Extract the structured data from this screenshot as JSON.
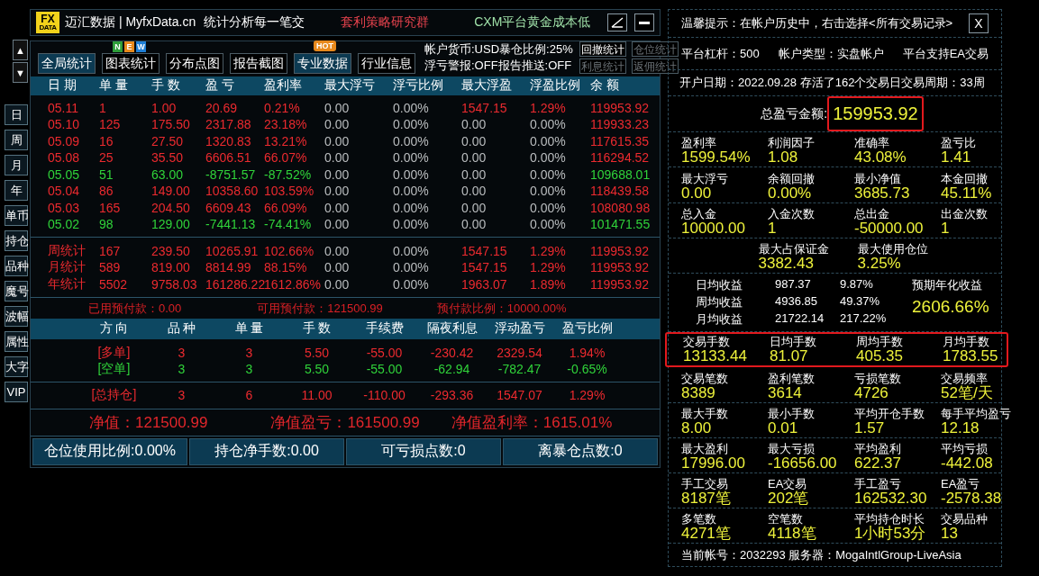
{
  "title_bar": {
    "logo": {
      "top": "FX",
      "bottom": "DATA"
    },
    "title": "迈汇数据 | MyfxData.cn",
    "slogan": "统计分析每一笔交",
    "promo": "套利策略研究群",
    "notice": "CXM平台黄金成本低"
  },
  "arrows": [
    "▲",
    "▼"
  ],
  "side_tabs": [
    "日",
    "周",
    "月",
    "年",
    "单币",
    "持仓",
    "品种",
    "魔号",
    "波幅",
    "属性",
    "大字",
    "VIP"
  ],
  "toolbar": [
    {
      "label": "全局统计",
      "selected": true
    },
    {
      "label": "图表统计",
      "selected": false,
      "badge": {
        "kind": "new",
        "letters": [
          {
            "text": "N",
            "color": "#2e9e3a"
          },
          {
            "text": "E",
            "color": "#e8891c"
          },
          {
            "text": "W",
            "color": "#1f7fd6"
          }
        ]
      }
    },
    {
      "label": "分布点图",
      "selected": false
    },
    {
      "label": "报告截图",
      "selected": false
    },
    {
      "label": "专业数据",
      "selected": true,
      "badge": {
        "kind": "hot",
        "text": "HOT"
      }
    },
    {
      "label": "行业信息",
      "selected": false
    }
  ],
  "account_info": [
    "帐户货币:USD暴仓比例:25%",
    "浮亏警报:OFF报告推送:OFF"
  ],
  "mini_buttons": [
    {
      "label": "回撤统计",
      "disabled": false
    },
    {
      "label": "仓位统计",
      "disabled": true
    },
    {
      "label": "利息统计",
      "disabled": true
    },
    {
      "label": "返佣统计",
      "disabled": true
    }
  ],
  "table": {
    "columns": [
      "日 期",
      "单 量",
      "手 数",
      "盈 亏",
      "盈利率",
      "最大浮亏",
      "浮亏比例",
      "最大浮盈",
      "浮盈比例",
      "余 额"
    ],
    "rows": [
      {
        "loss": false,
        "drawdown": false,
        "peak": true,
        "cells": [
          "05.11",
          "1",
          "1.00",
          "20.69",
          "0.21%",
          "0.00",
          "0.00%",
          "1547.15",
          "1.29%",
          "119953.92"
        ]
      },
      {
        "loss": false,
        "drawdown": false,
        "peak": false,
        "cells": [
          "05.10",
          "125",
          "175.50",
          "2317.88",
          "23.18%",
          "0.00",
          "0.00%",
          "0.00",
          "0.00%",
          "119933.23"
        ]
      },
      {
        "loss": false,
        "drawdown": false,
        "peak": false,
        "cells": [
          "05.09",
          "16",
          "27.50",
          "1320.83",
          "13.21%",
          "0.00",
          "0.00%",
          "0.00",
          "0.00%",
          "117615.35"
        ]
      },
      {
        "loss": false,
        "drawdown": false,
        "peak": false,
        "cells": [
          "05.08",
          "25",
          "35.50",
          "6606.51",
          "66.07%",
          "0.00",
          "0.00%",
          "0.00",
          "0.00%",
          "116294.52"
        ]
      },
      {
        "loss": true,
        "drawdown": false,
        "peak": false,
        "cells": [
          "05.05",
          "51",
          "63.00",
          "-8751.57",
          "-87.52%",
          "0.00",
          "0.00%",
          "0.00",
          "0.00%",
          "109688.01"
        ]
      },
      {
        "loss": false,
        "drawdown": false,
        "peak": false,
        "cells": [
          "05.04",
          "86",
          "149.00",
          "10358.60",
          "103.59%",
          "0.00",
          "0.00%",
          "0.00",
          "0.00%",
          "118439.58"
        ]
      },
      {
        "loss": false,
        "drawdown": false,
        "peak": false,
        "cells": [
          "05.03",
          "165",
          "204.50",
          "6609.43",
          "66.09%",
          "0.00",
          "0.00%",
          "0.00",
          "0.00%",
          "108080.98"
        ]
      },
      {
        "loss": true,
        "drawdown": false,
        "peak": false,
        "cells": [
          "05.02",
          "98",
          "129.00",
          "-7441.13",
          "-74.41%",
          "0.00",
          "0.00%",
          "0.00",
          "0.00%",
          "101471.55"
        ]
      }
    ],
    "summary_rows": [
      {
        "loss": false,
        "drawdown": false,
        "peak": true,
        "cells": [
          "周统计",
          "167",
          "239.50",
          "10265.91",
          "102.66%",
          "0.00",
          "0.00%",
          "1547.15",
          "1.29%",
          "119953.92"
        ]
      },
      {
        "loss": false,
        "drawdown": false,
        "peak": true,
        "cells": [
          "月统计",
          "589",
          "819.00",
          "8814.99",
          "88.15%",
          "0.00",
          "0.00%",
          "1547.15",
          "1.29%",
          "119953.92"
        ]
      },
      {
        "loss": false,
        "drawdown": false,
        "peak": true,
        "cells": [
          "年统计",
          "5502",
          "9758.03",
          "161286.22",
          "1612.86%",
          "0.00",
          "0.00%",
          "1963.07",
          "1.89%",
          "119953.92"
        ]
      }
    ]
  },
  "margin_line": [
    "已用预付款：0.00",
    "可用预付款：121500.99",
    "预付款比例：10000.00%"
  ],
  "positions": {
    "columns": [
      "方 向",
      "品 种",
      "单 量",
      "手 数",
      "手续费",
      "隔夜利息",
      "浮动盈亏",
      "盈亏比例"
    ],
    "rows": [
      {
        "loss": false,
        "cells": [
          "[多单]",
          "3",
          "3",
          "5.50",
          "-55.00",
          "-230.42",
          "2329.54",
          "1.94%"
        ]
      },
      {
        "loss": true,
        "cells": [
          "[空单]",
          "3",
          "3",
          "5.50",
          "-55.00",
          "-62.94",
          "-782.47",
          "-0.65%"
        ]
      }
    ],
    "total": {
      "loss": false,
      "cells": [
        "[总持仓]",
        "3",
        "6",
        "11.00",
        "-110.00",
        "-293.36",
        "1547.07",
        "1.29%"
      ]
    }
  },
  "equity_line": [
    "净值：121500.99",
    "净值盈亏：161500.99",
    "净值盈利率：1615.01%"
  ],
  "bottom_bar": [
    "仓位使用比例:0.00%",
    "持仓净手数:0.00",
    "可亏损点数:0",
    "离暴仓点数:0"
  ],
  "side_panel": {
    "tip": "温馨提示：在帐户历史中，右击选择<所有交易记录>",
    "close": "X",
    "account": [
      "平台杠杆：500",
      "帐户类型：实盘帐户",
      "平台支持EA交易"
    ],
    "opened": "开户日期：2022.09.28 存活了162个交易日交易周期：33周",
    "total": {
      "label": "总盈亏金额:",
      "value": "159953.92",
      "highlighted": true
    },
    "groups_a": [
      {
        "centered": false,
        "highlighted": false,
        "stats": [
          {
            "label": "盈利率",
            "value": "1599.54%"
          },
          {
            "label": "利润因子",
            "value": "1.08"
          },
          {
            "label": "准确率",
            "value": "43.08%"
          },
          {
            "label": "盈亏比",
            "value": "1.41"
          }
        ]
      },
      {
        "centered": false,
        "highlighted": false,
        "stats": [
          {
            "label": "最大浮亏",
            "value": "0.00"
          },
          {
            "label": "余额回撤",
            "value": "0.00%"
          },
          {
            "label": "最小净值",
            "value": "3685.73"
          },
          {
            "label": "本金回撤",
            "value": "45.11%"
          }
        ]
      },
      {
        "centered": false,
        "highlighted": false,
        "stats": [
          {
            "label": "总入金",
            "value": "10000.00"
          },
          {
            "label": "入金次数",
            "value": "1"
          },
          {
            "label": "总出金",
            "value": "-50000.00"
          },
          {
            "label": "出金次数",
            "value": "1"
          }
        ]
      },
      {
        "centered": true,
        "highlighted": false,
        "stats": [
          {
            "label": "最大占保证金",
            "value": "3382.43"
          },
          {
            "label": "最大使用仓位",
            "value": "3.25%"
          }
        ]
      }
    ],
    "averages": {
      "rows": [
        {
          "label": "日均收益",
          "amount": "987.37",
          "percent": "9.87%"
        },
        {
          "label": "周均收益",
          "amount": "4936.85",
          "percent": "49.37%"
        },
        {
          "label": "月均收益",
          "amount": "21722.14",
          "percent": "217.22%"
        }
      ],
      "annual": {
        "label": "预期年化收益",
        "value": "2606.66%"
      }
    },
    "groups_b": [
      {
        "centered": false,
        "highlighted": true,
        "stats": [
          {
            "label": "交易手数",
            "value": "13133.44"
          },
          {
            "label": "日均手数",
            "value": "81.07"
          },
          {
            "label": "周均手数",
            "value": "405.35"
          },
          {
            "label": "月均手数",
            "value": "1783.55"
          }
        ]
      },
      {
        "centered": false,
        "highlighted": false,
        "stats": [
          {
            "label": "交易笔数",
            "value": "8389"
          },
          {
            "label": "盈利笔数",
            "value": "3614"
          },
          {
            "label": "亏损笔数",
            "value": "4726"
          },
          {
            "label": "交易频率",
            "value": "52笔/天"
          }
        ]
      },
      {
        "centered": false,
        "highlighted": false,
        "stats": [
          {
            "label": "最大手数",
            "value": "8.00"
          },
          {
            "label": "最小手数",
            "value": "0.01"
          },
          {
            "label": "平均开仓手数",
            "value": "1.57"
          },
          {
            "label": "每手平均盈亏",
            "value": "12.18"
          }
        ]
      },
      {
        "centered": false,
        "highlighted": false,
        "stats": [
          {
            "label": "最大盈利",
            "value": "17996.00"
          },
          {
            "label": "最大亏损",
            "value": "-16656.00"
          },
          {
            "label": "平均盈利",
            "value": "622.37"
          },
          {
            "label": "平均亏损",
            "value": "-442.08"
          }
        ]
      },
      {
        "centered": false,
        "highlighted": false,
        "stats": [
          {
            "label": "手工交易",
            "value": "8187笔"
          },
          {
            "label": "EA交易",
            "value": "202笔"
          },
          {
            "label": "手工盈亏",
            "value": "162532.30"
          },
          {
            "label": "EA盈亏",
            "value": "-2578.38"
          }
        ]
      },
      {
        "centered": false,
        "highlighted": false,
        "stats": [
          {
            "label": "多笔数",
            "value": "4271笔"
          },
          {
            "label": "空笔数",
            "value": "4118笔"
          },
          {
            "label": "平均持仓时长",
            "value": "1小时53分"
          },
          {
            "label": "交易品种",
            "value": "13"
          }
        ]
      }
    ],
    "footer": "当前帐号：2032293 服务器：MogaIntlGroup-LiveAsia"
  }
}
